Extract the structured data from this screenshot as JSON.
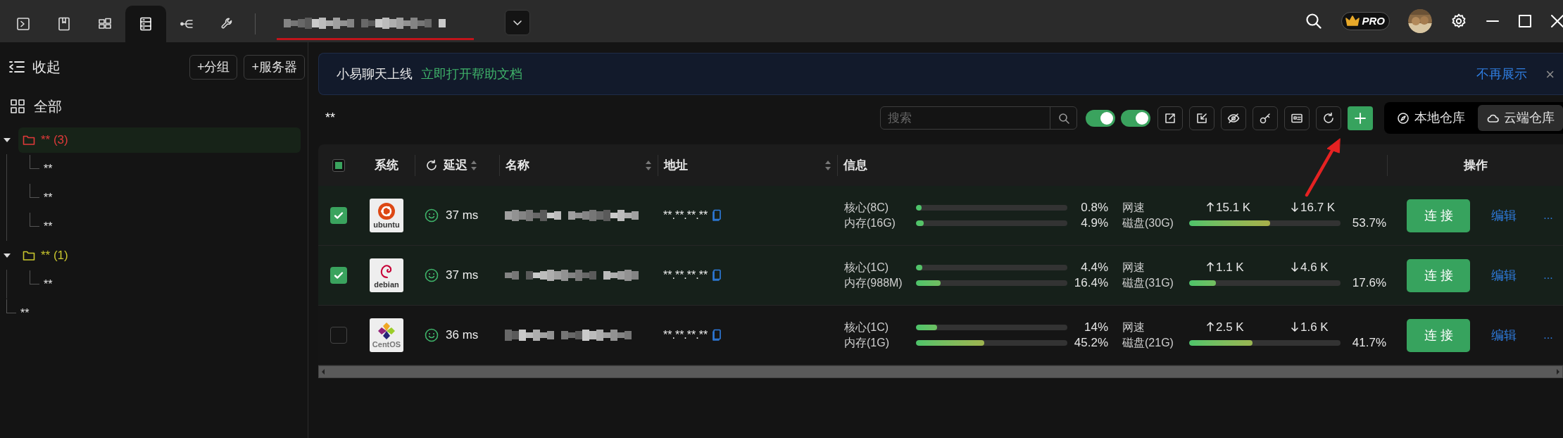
{
  "top_tabs": [
    {
      "kind": "terminal",
      "selected": false
    },
    {
      "kind": "book",
      "selected": false
    },
    {
      "kind": "windows",
      "selected": false
    },
    {
      "kind": "server",
      "selected": true
    },
    {
      "kind": "share",
      "selected": false
    },
    {
      "kind": "wrench",
      "selected": false
    }
  ],
  "top_right": {
    "badge": "PRO"
  },
  "sidebar": {
    "collapse": "收起",
    "add_group": "+分组",
    "add_server": "+服务器",
    "all": "全部",
    "tree": [
      {
        "kind": "group",
        "label": "** (3)",
        "color": "#e03a3a",
        "expanded": true,
        "selected": true,
        "children": [
          {
            "kind": "leaf",
            "label": "**"
          },
          {
            "kind": "leaf",
            "label": "**"
          },
          {
            "kind": "leaf",
            "label": "**"
          }
        ]
      },
      {
        "kind": "group",
        "label": "** (1)",
        "color": "#c9c62e",
        "expanded": true,
        "selected": false,
        "children": [
          {
            "kind": "leaf",
            "label": "**"
          }
        ]
      },
      {
        "kind": "leaf",
        "label": "**"
      }
    ]
  },
  "banner": {
    "text": "小易聊天上线",
    "link": "立即打开帮助文档",
    "dismiss": "不再展示",
    "close": "×"
  },
  "toolbar": {
    "title": "**",
    "search": {
      "placeholder": "搜索"
    },
    "toggles": [
      {
        "on": true
      },
      {
        "on": true
      }
    ],
    "repos": [
      {
        "kind": "local",
        "label": "本地仓库",
        "selected": false
      },
      {
        "kind": "cloud",
        "label": "云端仓库",
        "selected": true
      }
    ]
  },
  "table": {
    "header_checkbox": {
      "indeterminate": true
    },
    "columns": [
      {
        "kind": "system",
        "label": "系统"
      },
      {
        "kind": "latency",
        "label": "延迟",
        "sortable": true
      },
      {
        "kind": "name",
        "label": "名称",
        "sortable": true
      },
      {
        "kind": "address",
        "label": "地址",
        "sortable": true
      },
      {
        "kind": "info",
        "label": "信息"
      },
      {
        "kind": "actions",
        "label": "操作"
      }
    ],
    "rows": [
      {
        "selected": true,
        "os": {
          "kind": "ubuntu",
          "label": "ubuntu"
        },
        "latency": "37 ms",
        "address": "**.**.**.**",
        "cpu": {
          "label": "核心(8C)",
          "level": 0.008,
          "reading": "0.8%"
        },
        "mem": {
          "label": "内存(16G)",
          "level": 0.049,
          "reading": "4.9%"
        },
        "net": {
          "label": "网速",
          "up": "15.1 K",
          "down": "16.7 K"
        },
        "disk": {
          "label": "磁盘(30G)",
          "level": 0.537,
          "reading": "53.7%"
        },
        "connect": "连 接",
        "edit": "编辑",
        "more": "..."
      },
      {
        "selected": true,
        "os": {
          "kind": "debian",
          "label": "debian"
        },
        "latency": "37 ms",
        "address": "**.**.**.**",
        "cpu": {
          "label": "核心(1C)",
          "level": 0.044,
          "reading": "4.4%"
        },
        "mem": {
          "label": "内存(988M)",
          "level": 0.164,
          "reading": "16.4%"
        },
        "net": {
          "label": "网速",
          "up": "1.1 K",
          "down": "4.6 K"
        },
        "disk": {
          "label": "磁盘(31G)",
          "level": 0.176,
          "reading": "17.6%"
        },
        "connect": "连 接",
        "edit": "编辑",
        "more": "..."
      },
      {
        "selected": false,
        "os": {
          "kind": "centos",
          "label": "CentOS"
        },
        "latency": "36 ms",
        "address": "**.**.**.**",
        "cpu": {
          "label": "核心(1C)",
          "level": 0.14,
          "reading": "14%"
        },
        "mem": {
          "label": "内存(1G)",
          "level": 0.452,
          "reading": "45.2%"
        },
        "net": {
          "label": "网速",
          "up": "2.5 K",
          "down": "1.6 K"
        },
        "disk": {
          "label": "磁盘(21G)",
          "level": 0.417,
          "reading": "41.7%"
        },
        "connect": "连 接",
        "edit": "编辑",
        "more": "..."
      }
    ]
  }
}
